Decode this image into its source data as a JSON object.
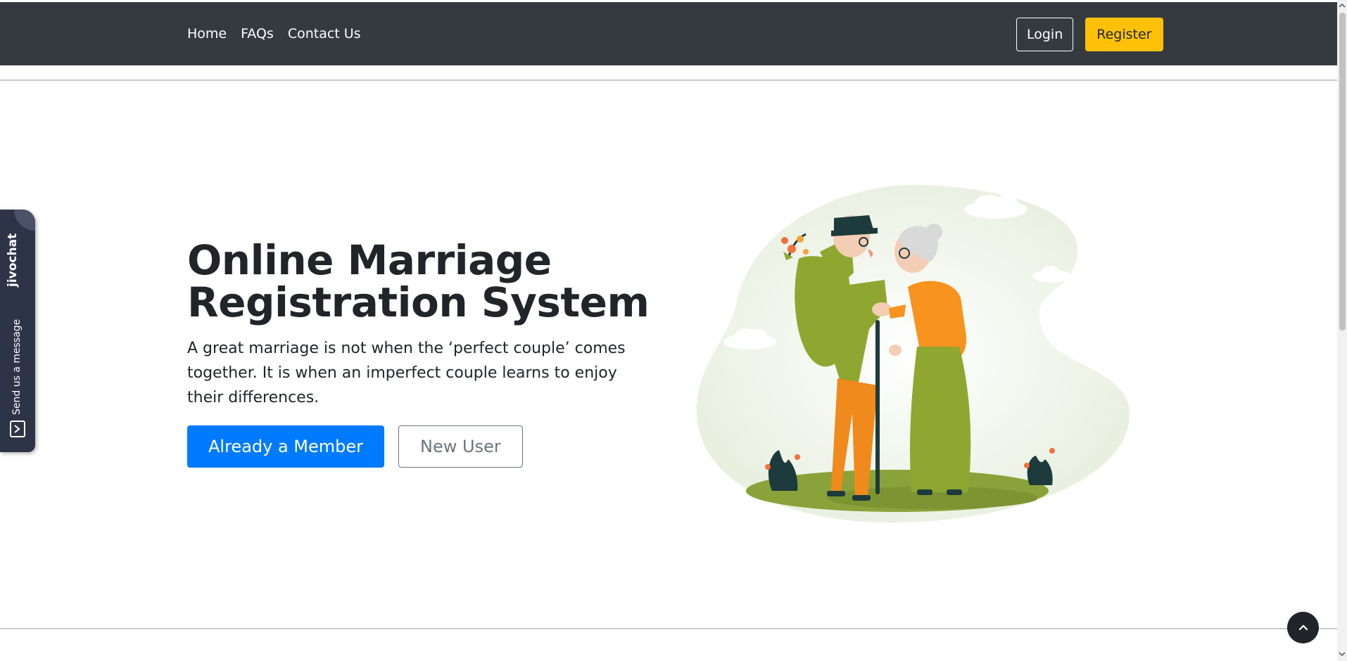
{
  "nav": {
    "links": [
      "Home",
      "FAQs",
      "Contact Us"
    ],
    "login_label": "Login",
    "register_label": "Register"
  },
  "hero": {
    "title_line1": "Online Marriage",
    "title_line2": "Registration System",
    "subtitle": "A great marriage is not when the ‘perfect couple’ comes together. It is when an imperfect couple learns to enjoy their differences.",
    "primary_button": "Already a Member",
    "secondary_button": "New User"
  },
  "chat_widget": {
    "brand": "jivochat",
    "message_label": "Send us a message"
  },
  "icons": {
    "scroll_top": "chevron-up-icon",
    "chat": "chat-bubble-icon"
  },
  "colors": {
    "navbar": "#343a40",
    "register": "#ffc107",
    "primary": "#007bff",
    "chat_widget": "#2e3448"
  }
}
